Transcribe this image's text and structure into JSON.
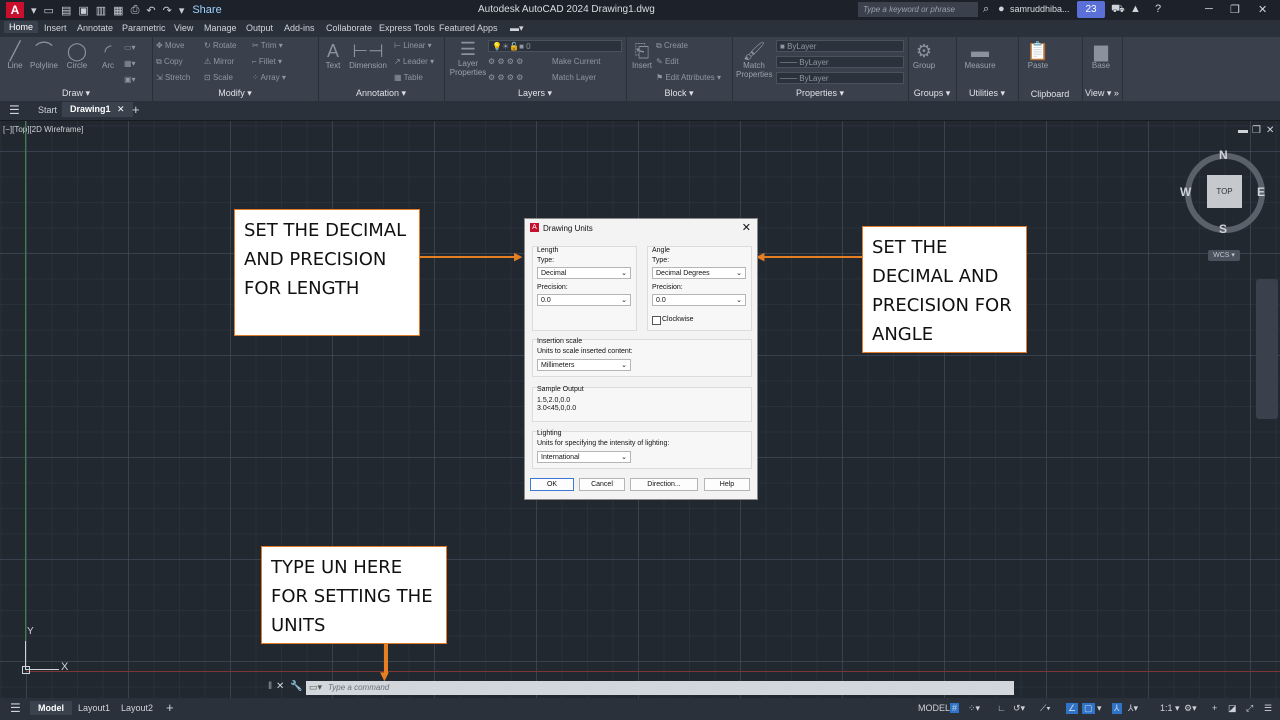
{
  "titlebar": {
    "app_logo": "A",
    "title": "Autodesk AutoCAD 2024   Drawing1.dwg",
    "share": "Share",
    "search_placeholder": "Type a keyword or phrase",
    "user": "samruddhiba...",
    "badge": "23"
  },
  "ribbon_tabs": [
    "Home",
    "Insert",
    "Annotate",
    "Parametric",
    "View",
    "Manage",
    "Output",
    "Add-ins",
    "Collaborate",
    "Express Tools",
    "Featured Apps"
  ],
  "ribbon": {
    "draw": {
      "label": "Draw",
      "tools": [
        "Line",
        "Polyline",
        "Circle",
        "Arc"
      ]
    },
    "modify": {
      "label": "Modify",
      "tools": [
        "Move",
        "Rotate",
        "Trim",
        "Copy",
        "Mirror",
        "Fillet",
        "Stretch",
        "Scale",
        "Array"
      ]
    },
    "annotation": {
      "label": "Annotation",
      "tools": [
        "Text",
        "Dimension",
        "Linear",
        "Leader",
        "Table"
      ]
    },
    "layers": {
      "label": "Layers",
      "tools": [
        "Layer Properties",
        "Make Current",
        "Match Layer"
      ],
      "layer_value": "0"
    },
    "block": {
      "label": "Block",
      "tools": [
        "Insert",
        "Create",
        "Edit",
        "Edit Attributes"
      ]
    },
    "properties": {
      "label": "Properties",
      "tools": [
        "Match Properties"
      ],
      "bylayer": "ByLayer"
    },
    "groups": {
      "label": "Groups",
      "tools": [
        "Group"
      ]
    },
    "utilities": {
      "label": "Utilities",
      "tools": [
        "Measure"
      ]
    },
    "clipboard": {
      "label": "Clipboard",
      "tools": [
        "Paste"
      ]
    },
    "view": {
      "label": "View",
      "tools": [
        "Base"
      ]
    }
  },
  "file_tabs": {
    "start": "Start",
    "drawing": "Drawing1"
  },
  "viewport_label": "[−][Top][2D Wireframe]",
  "viewcube": {
    "n": "N",
    "s": "S",
    "e": "E",
    "w": "W",
    "face": "TOP",
    "wcs": "WCS"
  },
  "ucs": {
    "x": "X",
    "y": "Y"
  },
  "annotations": {
    "length": "SET THE DECIMAL AND PRECISION FOR LENGTH",
    "angle": "SET THE DECIMAL AND PRECISION FOR ANGLE",
    "command": "TYPE UN HERE FOR SETTING THE UNITS"
  },
  "dialog": {
    "title": "Drawing Units",
    "length_group": "Length",
    "length_type_label": "Type:",
    "length_type": "Decimal",
    "length_precision_label": "Precision:",
    "length_precision": "0.0",
    "angle_group": "Angle",
    "angle_type_label": "Type:",
    "angle_type": "Decimal Degrees",
    "angle_precision_label": "Precision:",
    "angle_precision": "0.0",
    "clockwise": "Clockwise",
    "insertion_group": "Insertion scale",
    "insertion_label": "Units to scale inserted content:",
    "insertion_value": "Millimeters",
    "sample_group": "Sample Output",
    "sample_line1": "1.5,2.0,0.0",
    "sample_line2": "3.0<45,0,0.0",
    "lighting_group": "Lighting",
    "lighting_label": "Units for specifying the intensity of lighting:",
    "lighting_value": "International",
    "ok": "OK",
    "cancel": "Cancel",
    "direction": "Direction...",
    "help": "Help"
  },
  "command_placeholder": "Type a command",
  "status": {
    "model_tab": "Model",
    "layout1": "Layout1",
    "layout2": "Layout2",
    "model_mode": "MODEL",
    "scale": "1:1"
  }
}
